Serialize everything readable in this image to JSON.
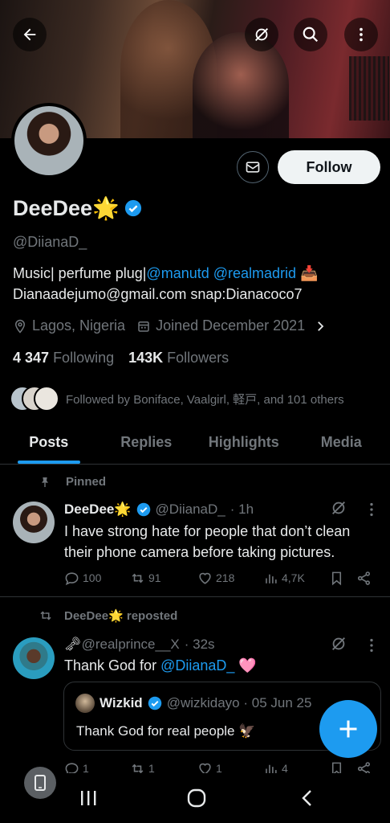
{
  "profile": {
    "name": "DeeDee",
    "name_emoji": "🌟",
    "handle": "@DiianaD_",
    "bio_line1_prefix": "Music| perfume plug|",
    "bio_mention1": "@manutd",
    "bio_mention2": "@realmadrid",
    "bio_emoji": "📥",
    "bio_line2": "Dianaadejumo@gmail.com snap:Dianacoco7",
    "location": "Lagos, Nigeria",
    "joined": "Joined December 2021",
    "following_count": "4 347",
    "following_label": "Following",
    "followers_count": "143K",
    "followers_label": "Followers",
    "followed_by": "Followed by Boniface, Vaalgirl, 軽戸, and 101 others"
  },
  "buttons": {
    "follow": "Follow"
  },
  "tabs": [
    "Posts",
    "Replies",
    "Highlights",
    "Media"
  ],
  "active_tab": "Posts",
  "pinned_label": "Pinned",
  "post1": {
    "name": "DeeDee",
    "emoji": "🌟",
    "handle": "@DiianaD_",
    "time": "· 1h",
    "text_line1": "I have strong hate for people that don’t clean",
    "text_line2": "their phone camera before taking pictures.",
    "replies": "100",
    "reposts": "91",
    "likes": "218",
    "views": "4,7K"
  },
  "repost_label": "DeeDee🌟 reposted",
  "post2": {
    "handle": "@realprince__X",
    "handle_icon": "🗝",
    "time": "· 32s",
    "text_prefix": "Thank God for ",
    "mention": "@DiianaD_",
    "emoji": "🩷",
    "replies": "1",
    "reposts": "1",
    "likes": "1",
    "views": "4"
  },
  "quote": {
    "name": "Wizkid",
    "handle_time": "@wizkidayo · 05 Jun 25",
    "text": "Thank God for real people",
    "emoji": "🦅"
  },
  "colors": {
    "accent": "#1d9bf0",
    "background": "#000000",
    "text": "#e7e9ea",
    "muted": "#71767b",
    "follow_bg": "#eff3f4"
  }
}
